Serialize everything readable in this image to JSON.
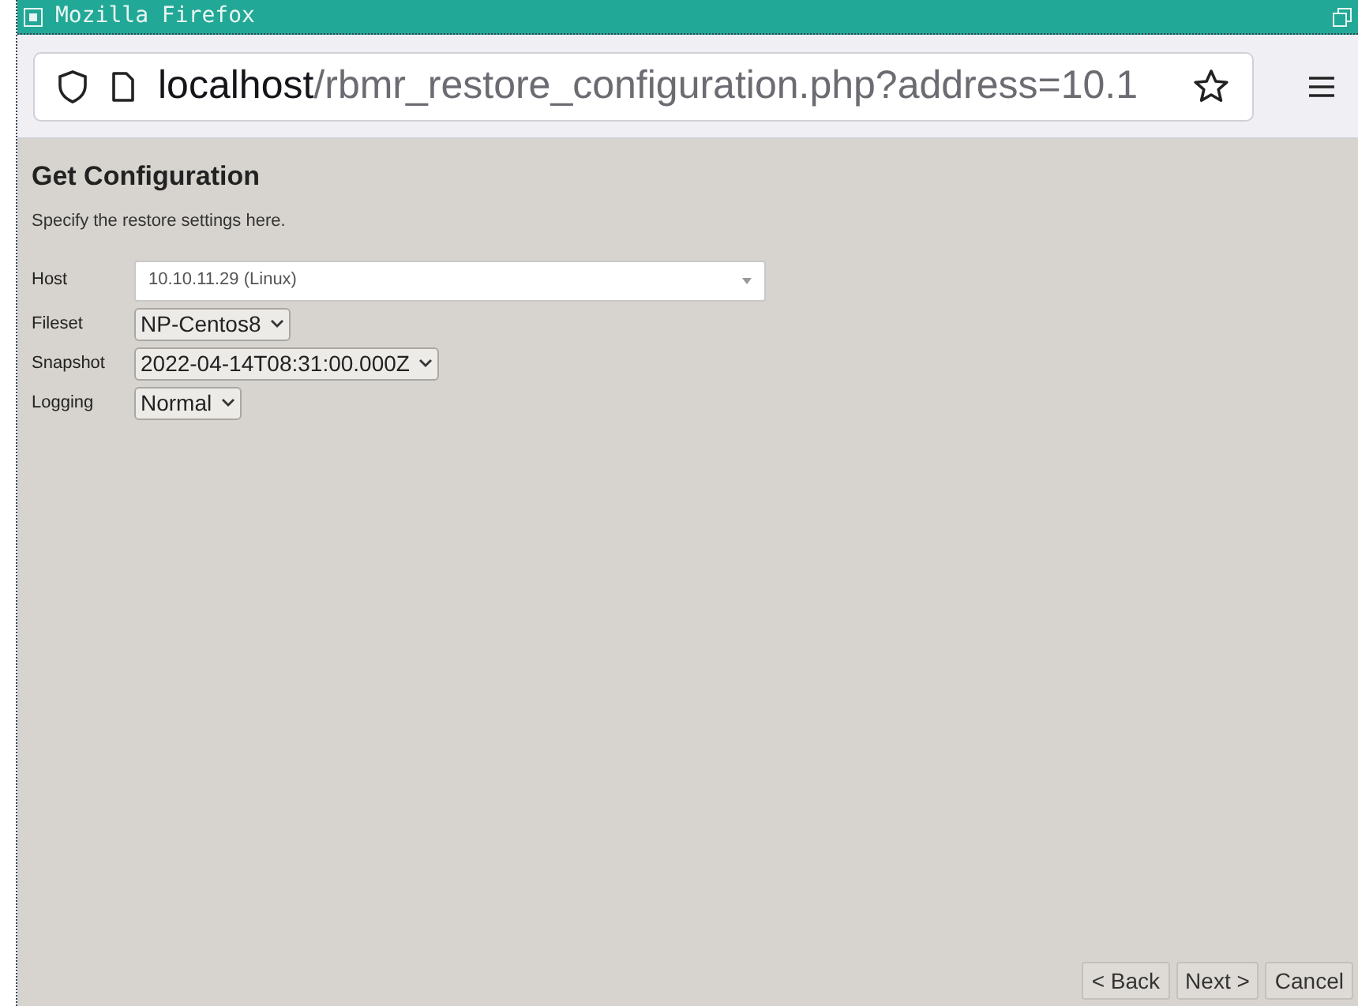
{
  "window": {
    "title": "Mozilla Firefox"
  },
  "address_bar": {
    "host": "localhost",
    "path": "/rbmr_restore_configuration.php?address=10.1"
  },
  "page": {
    "heading": "Get Configuration",
    "description": "Specify the restore settings here.",
    "fields": [
      {
        "label": "Host",
        "kind": "combo",
        "value": "10.10.11.29 (Linux)"
      },
      {
        "label": "Fileset",
        "kind": "select",
        "value": "NP-Centos8"
      },
      {
        "label": "Snapshot",
        "kind": "select",
        "value": "2022-04-14T08:31:00.000Z"
      },
      {
        "label": "Logging",
        "kind": "select",
        "value": "Normal"
      }
    ],
    "buttons": [
      "< Back",
      "Next >",
      "Cancel"
    ]
  }
}
